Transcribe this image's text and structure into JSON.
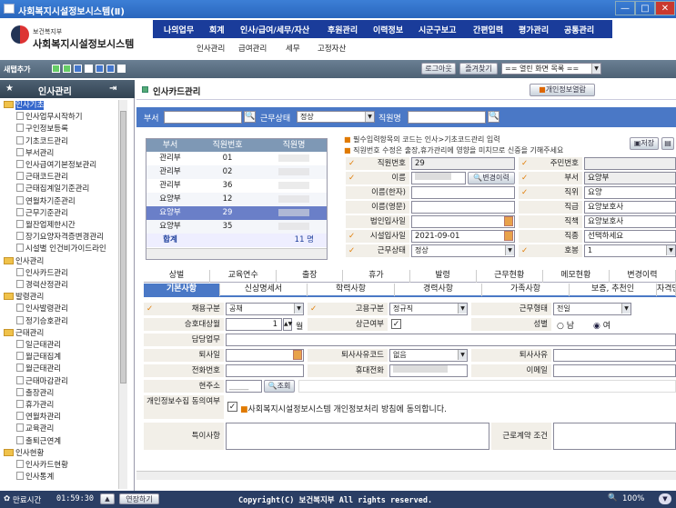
{
  "window": {
    "title": "사회복지시설정보시스템(Ⅱ)",
    "min": "—",
    "max": "□",
    "close": "✕"
  },
  "brand": {
    "ministry": "보건복지부",
    "system": "사회복지시설정보시스템"
  },
  "topnav": [
    "나의업무",
    "회계",
    "인사/급여/세무/자산",
    "후원관리",
    "이력정보",
    "시군구보고",
    "간편입력",
    "평가관리",
    "공통관리"
  ],
  "subnav": [
    "인사관리",
    "급여관리",
    "세무",
    "고정자산"
  ],
  "toolbar": {
    "newtab": "새탭추가",
    "logout": "로그아웃",
    "favorites": "즐겨찾기",
    "open_list": "== 열린 화면 목록 =="
  },
  "sidebar": {
    "title": "인사관리",
    "items": [
      {
        "label": "인사기초",
        "type": "folder",
        "selected": true
      },
      {
        "label": "인사업무시작하기",
        "type": "doc"
      },
      {
        "label": "구인정보등록",
        "type": "doc"
      },
      {
        "label": "기초코드관리",
        "type": "doc"
      },
      {
        "label": "부서관리",
        "type": "doc"
      },
      {
        "label": "인사급여기본정보관리",
        "type": "doc"
      },
      {
        "label": "근태코드관리",
        "type": "doc"
      },
      {
        "label": "근태집계일기준관리",
        "type": "doc"
      },
      {
        "label": "연월차기준관리",
        "type": "doc"
      },
      {
        "label": "근무기준관리",
        "type": "doc"
      },
      {
        "label": "월잔업제한시간",
        "type": "doc"
      },
      {
        "label": "장기요양자격증변경관리",
        "type": "doc"
      },
      {
        "label": "시설별 인건비가이드라인",
        "type": "doc"
      },
      {
        "label": "인사관리",
        "type": "folder"
      },
      {
        "label": "인사카드관리",
        "type": "doc"
      },
      {
        "label": "경력산정관리",
        "type": "doc"
      },
      {
        "label": "발령관리",
        "type": "folder"
      },
      {
        "label": "인사발령관리",
        "type": "doc"
      },
      {
        "label": "정기승호관리",
        "type": "doc"
      },
      {
        "label": "근태관리",
        "type": "folder"
      },
      {
        "label": "일근태관리",
        "type": "doc"
      },
      {
        "label": "월근태집계",
        "type": "doc"
      },
      {
        "label": "월근태관리",
        "type": "doc"
      },
      {
        "label": "근태마감관리",
        "type": "doc"
      },
      {
        "label": "출장관리",
        "type": "doc"
      },
      {
        "label": "휴가관리",
        "type": "doc"
      },
      {
        "label": "연월차관리",
        "type": "doc"
      },
      {
        "label": "교육관리",
        "type": "doc"
      },
      {
        "label": "출퇴근연계",
        "type": "doc"
      },
      {
        "label": "인사현황",
        "type": "folder"
      },
      {
        "label": "인사카드현황",
        "type": "doc"
      },
      {
        "label": "인사통계",
        "type": "doc"
      }
    ]
  },
  "page": {
    "title": "인사카드관리",
    "privacy_btn": "개인정보열람"
  },
  "search": {
    "dept_label": "부서",
    "dept_value": "",
    "status_label": "근무상태",
    "status_value": "정상",
    "name_label": "직원명",
    "name_value": ""
  },
  "grid": {
    "headers": [
      "부서",
      "직원번호",
      "직원명"
    ],
    "rows": [
      {
        "dept": "관리부",
        "no": "01"
      },
      {
        "dept": "관리부",
        "no": "02"
      },
      {
        "dept": "관리부",
        "no": "36"
      },
      {
        "dept": "요양부",
        "no": "12"
      },
      {
        "dept": "요양부",
        "no": "29",
        "selected": true
      },
      {
        "dept": "요양부",
        "no": "35"
      }
    ],
    "total_label": "합계",
    "total_value": "11 명"
  },
  "notice": {
    "line1": "필수입력항목의 코드는 인사>기초코드관리 입력",
    "line2": "직원번호 수정은 출장,휴가관리에 영향을 미치므로 신중을 기해주세요"
  },
  "buttons": {
    "save": "저장",
    "history": "변경이력"
  },
  "form": {
    "emp_no_label": "직원번호",
    "emp_no": "29",
    "name_label": "이름",
    "name": "",
    "name_hanja_label": "이름(한자)",
    "name_eng_label": "이름(영문)",
    "hire_label": "법인입사일",
    "start_label": "시설입사일",
    "start": "2021-09-01",
    "status_label": "근무상태",
    "status": "정상",
    "rrn_label": "주민번호",
    "dept_label": "부서",
    "dept": "요양부",
    "duty_label": "직위",
    "duty": "요양",
    "grade_label": "직급",
    "grade": "요양보호사",
    "role_label": "직책",
    "role": "요양보호사",
    "job_label": "직종",
    "job": "선택하세요",
    "rank_label": "호봉",
    "rank": "1"
  },
  "tabs_row1": [
    "상벌",
    "교육연수",
    "출장",
    "휴가",
    "발령",
    "근무현황",
    "메모현황",
    "변경이력"
  ],
  "tabs_row2": [
    "기본사항",
    "신상명세서",
    "학력사항",
    "경력사항",
    "가족사항",
    "보증, 추천인",
    "자격면허"
  ],
  "detail": {
    "hire_type_label": "채용구분",
    "hire_type": "공채",
    "emp_type_label": "고용구분",
    "emp_type": "정규직",
    "work_type_label": "근무형태",
    "work_type": "전일",
    "promo_label": "승호대상월",
    "promo": "1",
    "promo_unit": "월",
    "regular_label": "상근여부",
    "gender_label": "성별",
    "gender_m": "남",
    "gender_f": "여",
    "task_label": "담당업무",
    "retire_label": "퇴사일",
    "retire_code_label": "퇴사사유코드",
    "retire_code": "없음",
    "retire_reason_label": "퇴사사유",
    "phone_label": "전화번호",
    "mobile_label": "휴대전화",
    "email_label": "이메일",
    "addr_label": "현주소",
    "addr_zip": "_____",
    "addr_btn": "조회",
    "consent_label": "개인정보수집 동의여부",
    "consent_text": "사회복지시설정보시스템 개인정보처리 방침에 동의합니다.",
    "notes_label": "특이사항",
    "contract_label": "근로계약 조건"
  },
  "status": {
    "timer_label": "만료시간",
    "timer": "01:59:30",
    "extend": "연장하기",
    "copyright": "Copyright(C) 보건복지부 All rights reserved.",
    "zoom": "100%"
  }
}
